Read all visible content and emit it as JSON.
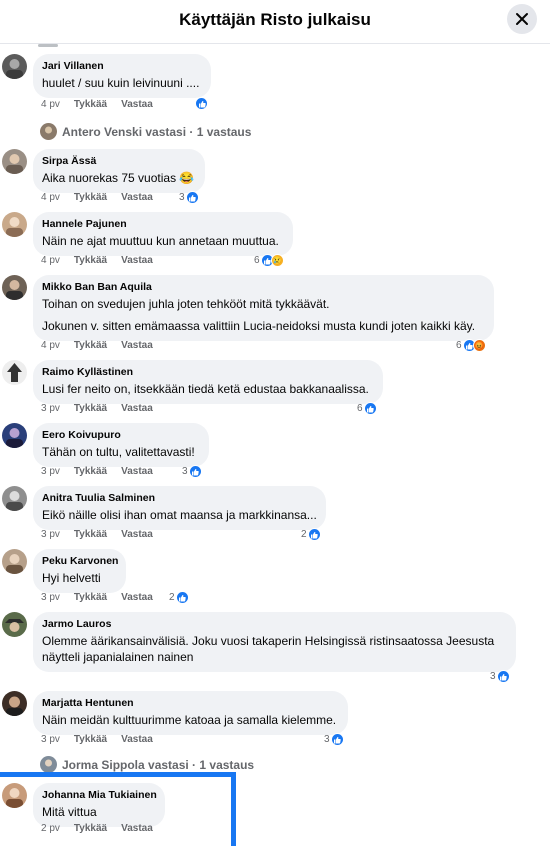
{
  "header": {
    "title": "Käyttäjän Risto julkaisu"
  },
  "actions": {
    "like": "Tykkää",
    "reply": "Vastaa"
  },
  "comments": [
    {
      "name": "Jari Villanen",
      "lines": [
        "huulet / suu kuin leivinuuni ...."
      ],
      "time": "4 pv",
      "reactions": {
        "count": "",
        "icons": [
          "like"
        ]
      }
    },
    {
      "name": "Sirpa Ässä",
      "lines": [
        "Aika nuorekas 75 vuotias 😂"
      ],
      "time": "4 pv",
      "reactions": {
        "count": "3",
        "icons": [
          "like"
        ]
      }
    },
    {
      "name": "Hannele Pajunen",
      "lines": [
        "Näin ne ajat muuttuu kun annetaan muuttua."
      ],
      "time": "4 pv",
      "reactions": {
        "count": "6",
        "icons": [
          "like",
          "sad"
        ]
      }
    },
    {
      "name": "Mikko Ban Ban Aquila",
      "lines": [
        "Toihan on svedujen juhla joten tehkööt mitä tykkäävät.",
        "Jokunen v. sitten emämaassa valittiin Lucia-neidoksi musta kundi joten kaikki käy."
      ],
      "time": "4 pv",
      "reactions": {
        "count": "6",
        "icons": [
          "like",
          "angry"
        ]
      }
    },
    {
      "name": "Raimo Kyllästinen",
      "lines": [
        "Lusi fer neito on, itsekkään tiedä ketä edustaa bakkanaalissa."
      ],
      "time": "3 pv",
      "reactions": {
        "count": "6",
        "icons": [
          "like"
        ]
      }
    },
    {
      "name": "Eero Koivupuro",
      "lines": [
        "Tähän on tultu, valitettavasti!"
      ],
      "time": "3 pv",
      "reactions": {
        "count": "3",
        "icons": [
          "like"
        ]
      }
    },
    {
      "name": "Anitra Tuulia Salminen",
      "lines": [
        "Eikö näille olisi ihan omat maansa ja markkinansa..."
      ],
      "time": "3 pv",
      "reactions": {
        "count": "2",
        "icons": [
          "like"
        ]
      }
    },
    {
      "name": "Peku Karvonen",
      "lines": [
        "Hyi helvetti"
      ],
      "time": "3 pv",
      "reactions": {
        "count": "2",
        "icons": [
          "like"
        ]
      }
    },
    {
      "name": "Jarmo Lauros",
      "lines": [
        "Olemme äärikansainvälisiä. Joku vuosi takaperin Helsingissä ristinsaatossa Jeesusta",
        "näytteli japanialainen nainen"
      ],
      "time": "3 pv",
      "reactions": {
        "count": "3",
        "icons": [
          "like"
        ]
      }
    },
    {
      "name": "Marjatta Hentunen",
      "lines": [
        "Näin meidän kulttuurimme katoaa ja samalla kielemme."
      ],
      "time": "3 pv",
      "reactions": {
        "count": "3",
        "icons": [
          "like"
        ]
      }
    },
    {
      "name": "Johanna Mia Tukiainen",
      "lines": [
        "Mitä vittua"
      ],
      "time": "2 pv",
      "reactions": {
        "count": "",
        "icons": []
      }
    }
  ],
  "reply_links": [
    {
      "text": "Antero Venski vastasi · 1 vastaus"
    },
    {
      "text": "Jorma Sippola vastasi · 1 vastaus"
    }
  ],
  "colors": {
    "accent": "#1877f2",
    "bubble": "#f0f2f5",
    "muted": "#65676b"
  }
}
